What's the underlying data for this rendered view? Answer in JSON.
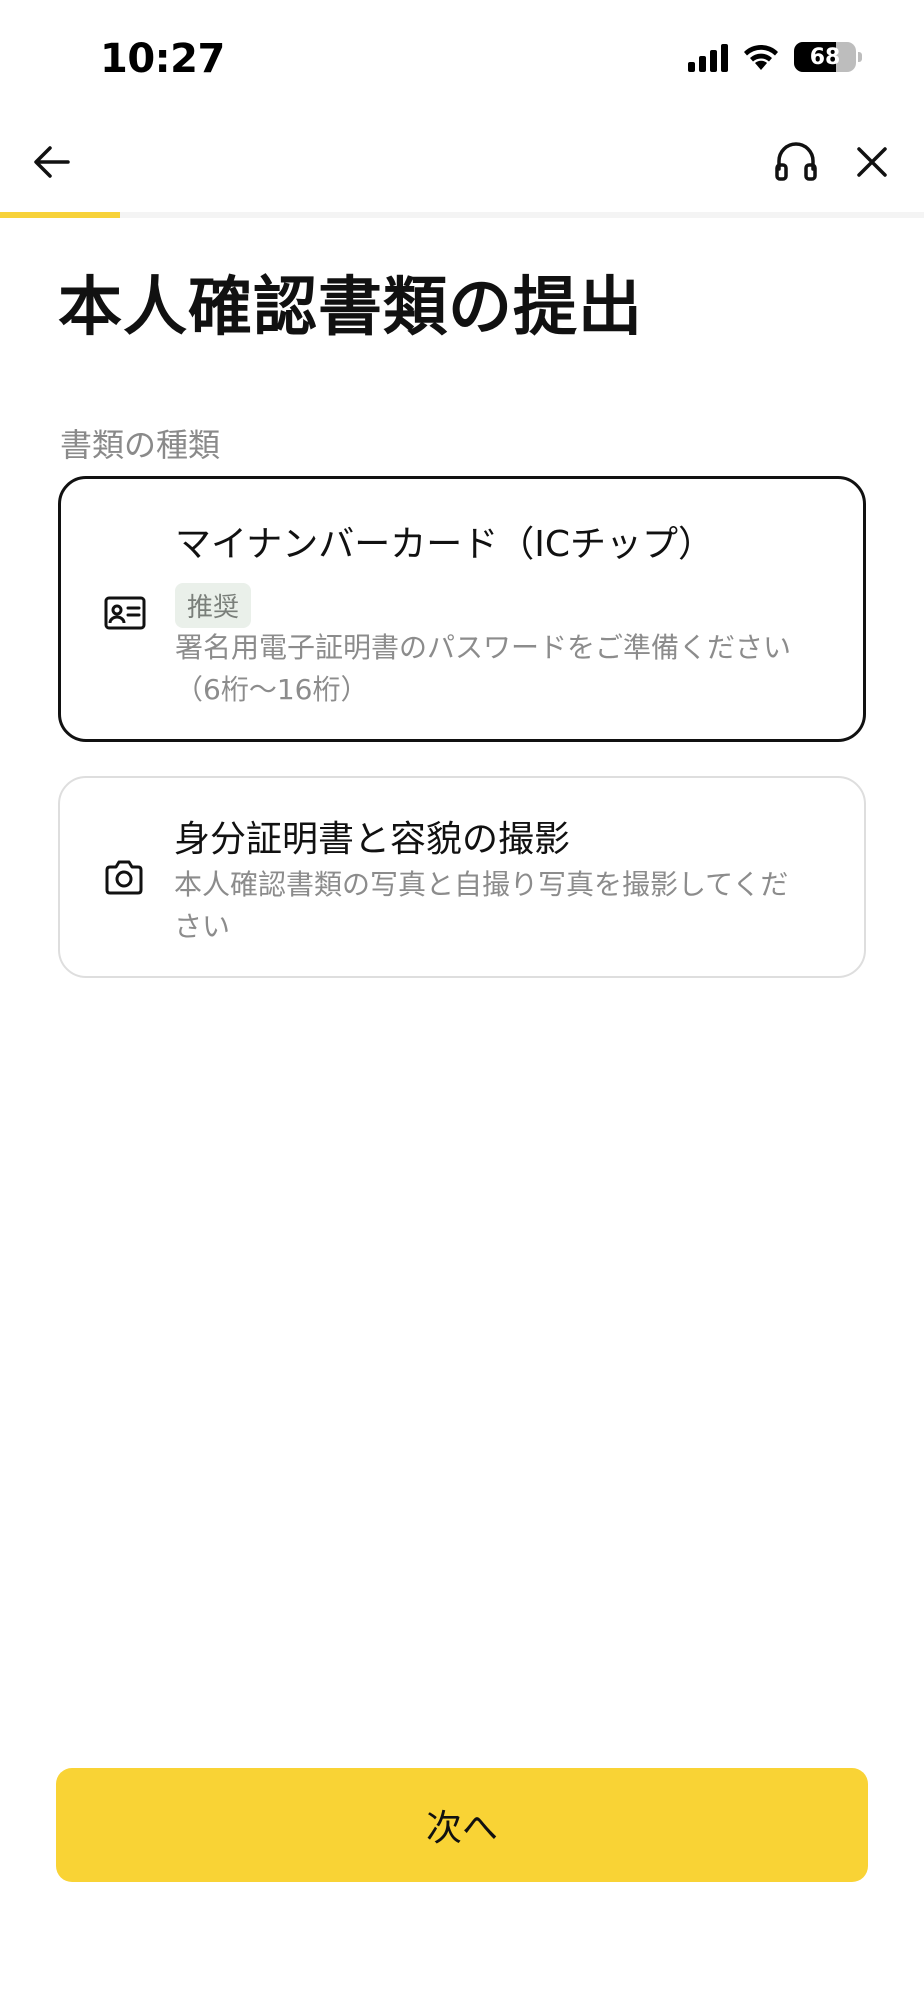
{
  "status_bar": {
    "time": "10:27",
    "battery": "68",
    "battery_level": 0.68,
    "icons": [
      "signal-icon",
      "wifi-icon",
      "battery-icon"
    ]
  },
  "nav": {
    "icons": [
      "arrow-left-icon",
      "headset-icon",
      "close-icon"
    ]
  },
  "progress": {
    "fraction": 0.13,
    "color": "#f7d23a"
  },
  "page": {
    "title": "本人確認書類の提出",
    "section_label": "書類の種類"
  },
  "options": [
    {
      "title": "マイナンバーカード（ICチップ）",
      "badge": "推奨",
      "description": "署名用電子証明書のパスワードをご準備ください（6桁〜16桁）",
      "icon": "id-card-icon",
      "selected": true
    },
    {
      "title": "身分証明書と容貌の撮影",
      "description": "本人確認書類の写真と自撮り写真を撮影してください",
      "icon": "camera-icon",
      "selected": false
    }
  ],
  "footer": {
    "next_label": "次へ",
    "button_color": "#f9d335"
  }
}
